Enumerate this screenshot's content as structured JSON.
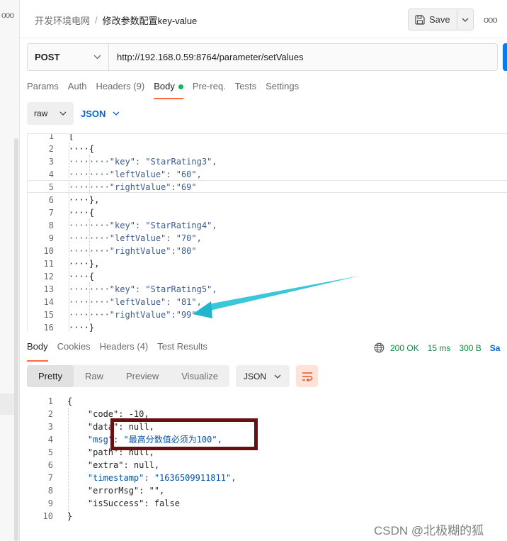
{
  "header": {
    "breadcrumb_parent": "开发环境电网",
    "breadcrumb_sep": "/",
    "breadcrumb_current": "修改参数配置key-value",
    "save_label": "Save",
    "more": "ooo"
  },
  "left_strip": {
    "dots": "ooo"
  },
  "request": {
    "method": "POST",
    "url": "http://192.168.0.59:8764/parameter/setValues"
  },
  "request_tabs": [
    {
      "label": "Params"
    },
    {
      "label": "Auth"
    },
    {
      "label": "Headers (9)"
    },
    {
      "label": "Body"
    },
    {
      "label": "Pre-req."
    },
    {
      "label": "Tests"
    },
    {
      "label": "Settings"
    }
  ],
  "body_mode": {
    "mode": "raw",
    "format": "JSON"
  },
  "request_code": [
    {
      "ln": "1",
      "code": "["
    },
    {
      "ln": "2",
      "code": "····{"
    },
    {
      "ln": "3",
      "code": "········\"key\": \"StarRating3\","
    },
    {
      "ln": "4",
      "code": "········\"leftValue\": \"60\","
    },
    {
      "ln": "5",
      "code": "········\"rightValue\":\"69\""
    },
    {
      "ln": "6",
      "code": "····},"
    },
    {
      "ln": "7",
      "code": "····{"
    },
    {
      "ln": "8",
      "code": "········\"key\": \"StarRating4\","
    },
    {
      "ln": "9",
      "code": "········\"leftValue\": \"70\","
    },
    {
      "ln": "10",
      "code": "········\"rightValue\":\"80\""
    },
    {
      "ln": "11",
      "code": "····},"
    },
    {
      "ln": "12",
      "code": "····{"
    },
    {
      "ln": "13",
      "code": "········\"key\": \"StarRating5\","
    },
    {
      "ln": "14",
      "code": "········\"leftValue\": \"81\","
    },
    {
      "ln": "15",
      "code": "········\"rightValue\":\"99\""
    },
    {
      "ln": "16",
      "code": "····}"
    }
  ],
  "response_tabs": [
    {
      "label": "Body"
    },
    {
      "label": "Cookies"
    },
    {
      "label": "Headers (4)"
    },
    {
      "label": "Test Results"
    }
  ],
  "response_status": {
    "status": "200 OK",
    "time": "15 ms",
    "size": "300 B",
    "save_label": "Sa"
  },
  "response_views": [
    {
      "label": "Pretty"
    },
    {
      "label": "Raw"
    },
    {
      "label": "Preview"
    },
    {
      "label": "Visualize"
    }
  ],
  "response_format": "JSON",
  "response_code": [
    {
      "ln": "1",
      "code": "{"
    },
    {
      "ln": "2",
      "code": "    \"code\": -10,"
    },
    {
      "ln": "3",
      "code": "    \"data\": null,"
    },
    {
      "ln": "4",
      "code": "    \"msg\": \"最高分数值必须为100\","
    },
    {
      "ln": "5",
      "code": "    \"path\": null,"
    },
    {
      "ln": "6",
      "code": "    \"extra\": null,"
    },
    {
      "ln": "7",
      "code": "    \"timestamp\": \"1636509911811\","
    },
    {
      "ln": "8",
      "code": "    \"errorMsg\": \"\","
    },
    {
      "ln": "9",
      "code": "    \"isSuccess\": false"
    },
    {
      "ln": "10",
      "code": "}"
    }
  ],
  "watermark": "CSDN @北极糊的狐"
}
